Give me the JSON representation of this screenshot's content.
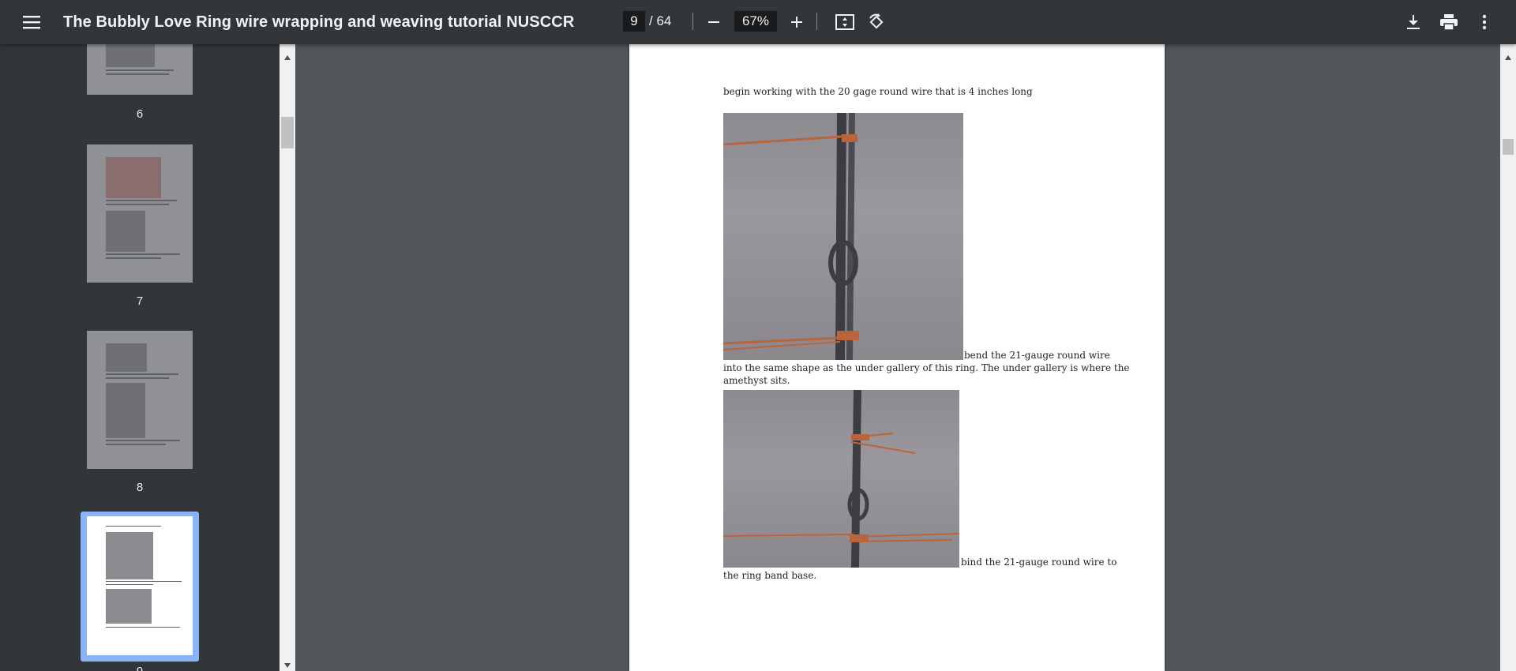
{
  "toolbar": {
    "title": "The Bubbly Love Ring wire wrapping and weaving tutorial NUSCCR",
    "current_page": "9",
    "total_pages": "/ 64",
    "zoom": "67%"
  },
  "sidebar": {
    "thumbnails": [
      {
        "label": "6"
      },
      {
        "label": "7"
      },
      {
        "label": "8"
      },
      {
        "label": "9"
      }
    ]
  },
  "page": {
    "line1": "begin working with the 20 gage round wire that is 4 inches long",
    "caption1_inline": "bend the 21-gauge round wire",
    "caption1_line2": "into the same shape as the under gallery of this ring. The under gallery is where the",
    "caption1_line3": "amethyst sits.",
    "caption2_inline": "bind the 21-gauge round wire to",
    "caption2_line2": "the ring band base."
  },
  "icons": {
    "menu": "hamburger-menu-icon",
    "zoom_out": "minus-icon",
    "zoom_in": "plus-icon",
    "fit": "fit-to-page-icon",
    "rotate": "rotate-icon",
    "download": "download-icon",
    "print": "print-icon",
    "more": "more-vert-icon"
  }
}
